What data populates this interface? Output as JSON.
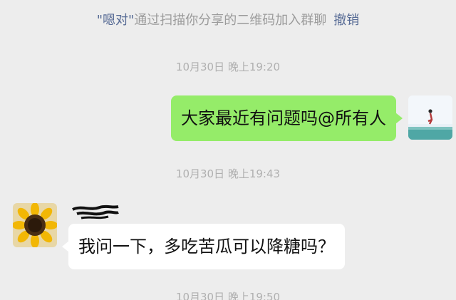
{
  "system_notice": {
    "name": "\"嗯对\"",
    "text": "通过扫描你分享的二维码加入群聊",
    "revoke_label": "撤销"
  },
  "timestamps": [
    "10月30日 晚上19:20",
    "10月30日 晚上19:43",
    "10月30日 晚上19:50"
  ],
  "messages": [
    {
      "from": "me",
      "text": "大家最近有问题吗@所有人",
      "avatar_icon": "beach-person-avatar"
    },
    {
      "from": "other",
      "text": "我问一下，多吃苦瓜可以降糖吗？",
      "avatar_icon": "sunflower-avatar"
    }
  ],
  "colors": {
    "background": "#ededed",
    "bubble_me": "#95ec69",
    "bubble_other": "#ffffff",
    "link": "#576b95"
  }
}
